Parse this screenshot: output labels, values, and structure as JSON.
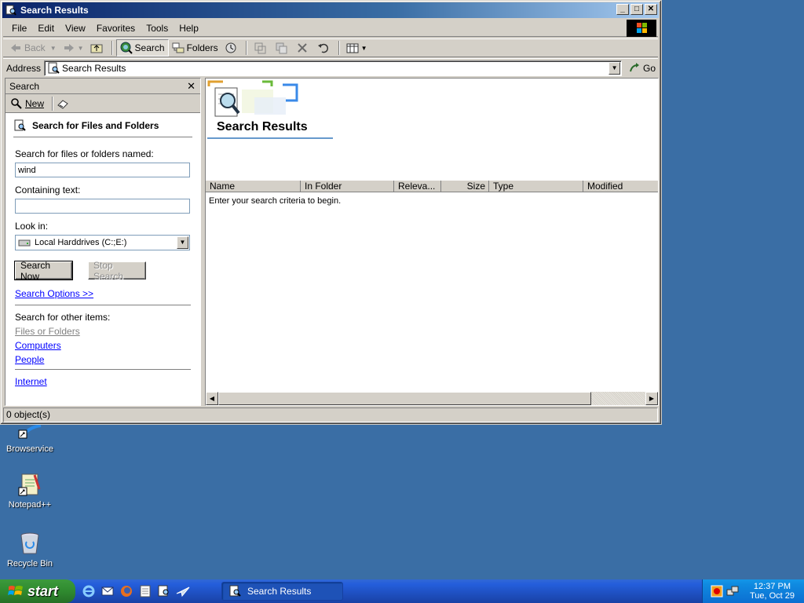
{
  "colors": {
    "desktop": "#3a6ea5",
    "title_active": "#0a246a",
    "taskbar": "#245edb",
    "start": "#2f8a2f",
    "link": "#0000ff"
  },
  "window": {
    "title": "Search Results",
    "title_icon": "search-results-icon",
    "menu": [
      "File",
      "Edit",
      "View",
      "Favorites",
      "Tools",
      "Help"
    ],
    "toolbar": {
      "back": "Back",
      "search": "Search",
      "folders": "Folders"
    },
    "address": {
      "label": "Address",
      "value": "Search Results",
      "go": "Go"
    },
    "status": "0 object(s)"
  },
  "search_pane": {
    "header": "Search",
    "new_label": "New",
    "title": "Search for Files and Folders",
    "named_label": "Search for files or folders named:",
    "named_value": "wind",
    "containing_label": "Containing text:",
    "containing_value": "",
    "look_in_label": "Look in:",
    "look_in_value": "Local Harddrives (C:;E:)",
    "search_now": "Search Now",
    "stop_search": "Stop Search",
    "options_link": "Search Options >>",
    "other_label": "Search for other items:",
    "other_items": [
      "Files or Folders",
      "Computers",
      "People"
    ],
    "internet": "Internet"
  },
  "results": {
    "banner_title": "Search Results",
    "columns": [
      "Name",
      "In Folder",
      "Releva...",
      "Size",
      "Type",
      "Modified"
    ],
    "empty_message": "Enter your search criteria to begin."
  },
  "desktop_icons": [
    {
      "label": "Browservice",
      "icon": "browservice-icon"
    },
    {
      "label": "Notepad++",
      "icon": "notepad-plus-plus-icon"
    },
    {
      "label": "Recycle Bin",
      "icon": "recycle-bin-icon"
    }
  ],
  "taskbar": {
    "start": "start",
    "task": "Search Results",
    "time": "12:37 PM",
    "date": "Tue, Oct 29"
  }
}
